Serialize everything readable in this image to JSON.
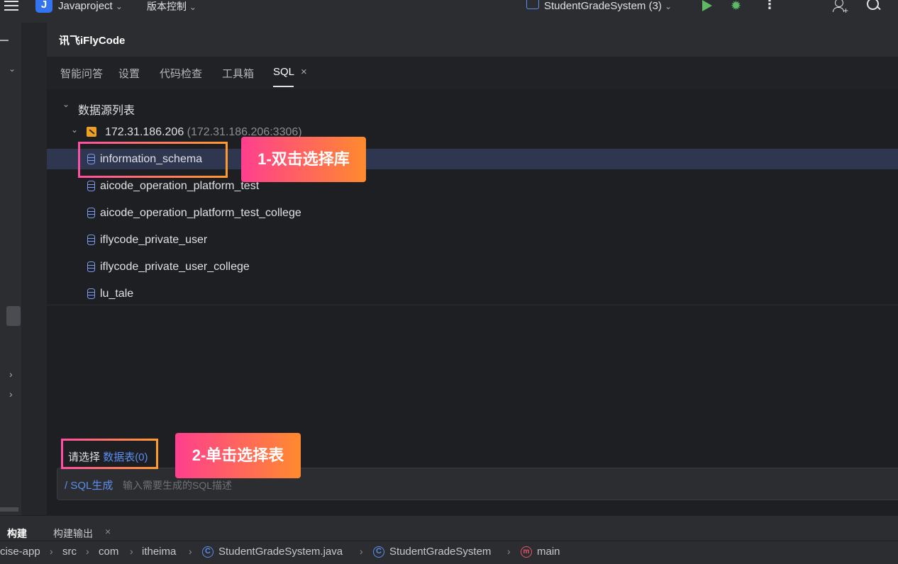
{
  "topbar": {
    "project_badge": "J",
    "project_name": "Javaproject",
    "vcs_label": "版本控制",
    "run_config": "StudentGradeSystem (3)"
  },
  "panel": {
    "title": "讯飞iFlyCode",
    "tabs": [
      {
        "label": "智能问答"
      },
      {
        "label": "设置"
      },
      {
        "label": "代码检查"
      },
      {
        "label": "工具箱"
      },
      {
        "label": "SQL"
      }
    ],
    "tree": {
      "root_label": "数据源列表",
      "host_label": "172.31.186.206",
      "host_detail": "(172.31.186.206:3306)",
      "databases": [
        "information_schema",
        "aicode_operation_platform_test",
        "aicode_operation_platform_test_college",
        "iflycode_private_user",
        "iflycode_private_user_college",
        "lu_tale"
      ]
    },
    "select_prompt": "请选择",
    "select_link": "数据表(0)",
    "input": {
      "command": "/ SQL生成",
      "placeholder": "输入需要生成的SQL描述"
    }
  },
  "callouts": {
    "step1": "1-双击选择库",
    "step2": "2-单击选择表"
  },
  "bottom_tool": {
    "tab_build": "构建",
    "tab_build_output": "构建输出"
  },
  "breadcrumb": {
    "items": [
      "cise-app",
      "src",
      "com",
      "itheima",
      "StudentGradeSystem.java",
      "StudentGradeSystem",
      "main"
    ]
  },
  "colors": {
    "accent": "#3574f0",
    "callout_start": "#ff3f8e",
    "callout_end": "#ff8a2e",
    "selection": "#2e3650"
  }
}
